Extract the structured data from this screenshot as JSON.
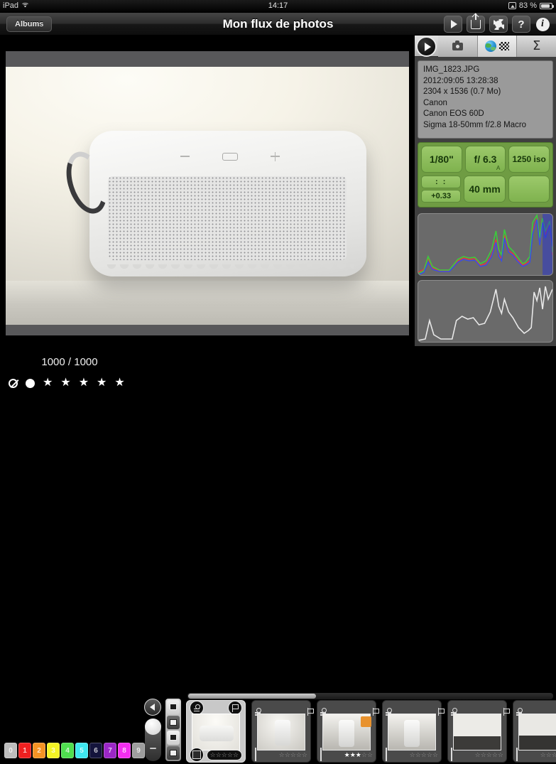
{
  "status_bar": {
    "device": "iPad",
    "wifi_icon": "wifi-icon",
    "time": "14:17",
    "rotation_lock_icon": "rotation-lock-icon",
    "battery_percent": "83 %",
    "battery_icon": "battery-icon"
  },
  "navbar": {
    "back_label": "Albums",
    "title": "Mon flux de photos",
    "actions": [
      {
        "name": "play-button",
        "icon": "play-icon"
      },
      {
        "name": "share-button",
        "icon": "share-icon"
      },
      {
        "name": "settings-button",
        "icon": "gear-icon"
      },
      {
        "name": "help-button",
        "icon": "question-mark-icon",
        "label": "?"
      },
      {
        "name": "info-button",
        "icon": "info-icon",
        "label": "i"
      }
    ]
  },
  "info_panel": {
    "tabs": [
      {
        "name": "tab-play",
        "icon": "play-circle-icon",
        "active": false
      },
      {
        "name": "tab-camera",
        "icon": "camera-icon",
        "active": false
      },
      {
        "name": "tab-map",
        "icon": "globe-icon",
        "active": true
      },
      {
        "name": "tab-sigma",
        "icon": "sigma-icon",
        "label": "Σ",
        "active": false
      }
    ],
    "exif": {
      "filename": "IMG_1823.JPG",
      "datetime": "2012:09:05 13:28:38",
      "dimensions": "2304 x 1536 (0.7 Mo)",
      "make": "Canon",
      "model": "Canon EOS 60D",
      "lens": "Sigma 18-50mm f/2.8 Macro"
    },
    "exposure": {
      "shutter": "1/80\"",
      "aperture": "f/ 6.3",
      "aperture_mode": "A",
      "iso": "1250 iso",
      "flash": ": :",
      "exposure_compensation": "+0.33",
      "focal_length": "40 mm",
      "empty": ""
    },
    "histograms": [
      {
        "name": "rgb-histogram",
        "type": "rgb"
      },
      {
        "name": "luminance-histogram",
        "type": "luminance"
      }
    ]
  },
  "bottom_bar": {
    "counter": "1000 / 1000",
    "rating_icons": [
      {
        "name": "reject-icon",
        "glyph": ""
      },
      {
        "name": "pick-dot-icon",
        "glyph": ""
      },
      {
        "name": "star-1-icon",
        "glyph": "★"
      },
      {
        "name": "star-2-icon",
        "glyph": "★"
      },
      {
        "name": "star-3-icon",
        "glyph": "★"
      },
      {
        "name": "star-4-icon",
        "glyph": "★"
      },
      {
        "name": "star-5-icon",
        "glyph": "★"
      }
    ],
    "color_labels": [
      {
        "label": "0",
        "color": "#bdbdbd"
      },
      {
        "label": "1",
        "color": "#ef2020"
      },
      {
        "label": "2",
        "color": "#f59324"
      },
      {
        "label": "3",
        "color": "#f5f525"
      },
      {
        "label": "4",
        "color": "#4fe04f"
      },
      {
        "label": "5",
        "color": "#3fe8f0"
      },
      {
        "label": "6",
        "color": "#14143c"
      },
      {
        "label": "7",
        "color": "#9b27c6"
      },
      {
        "label": "8",
        "color": "#f32ef0"
      },
      {
        "label": "9",
        "color": "#9e9e9e"
      }
    ],
    "prev_button": "previous-photo-button",
    "zoom_slider": "zoom-slider",
    "view_modes": [
      "view-mode-1",
      "view-mode-2",
      "view-mode-3",
      "view-mode-4"
    ]
  },
  "filmstrip": {
    "scrollbar": "filmstrip-scrollbar",
    "thumbnails": [
      {
        "selected": true,
        "stars_filled": 0,
        "art": "a",
        "color_label": "",
        "checked": false
      },
      {
        "selected": false,
        "stars_filled": 0,
        "art": "b",
        "color_label": "",
        "checked": false
      },
      {
        "selected": false,
        "stars_filled": 3,
        "art": "c",
        "color_label": "#e8922e",
        "checked": false
      },
      {
        "selected": false,
        "stars_filled": 0,
        "art": "c",
        "color_label": "",
        "checked": false
      },
      {
        "selected": false,
        "stars_filled": 0,
        "art": "d",
        "color_label": "",
        "checked": false
      },
      {
        "selected": false,
        "stars_filled": 0,
        "art": "e",
        "color_label": "",
        "checked": false
      }
    ]
  },
  "viewer": {
    "photo_alt": "white-bluetooth-speaker-photo",
    "speaker_controls": [
      "minus-button",
      "display-button",
      "plus-button"
    ]
  }
}
